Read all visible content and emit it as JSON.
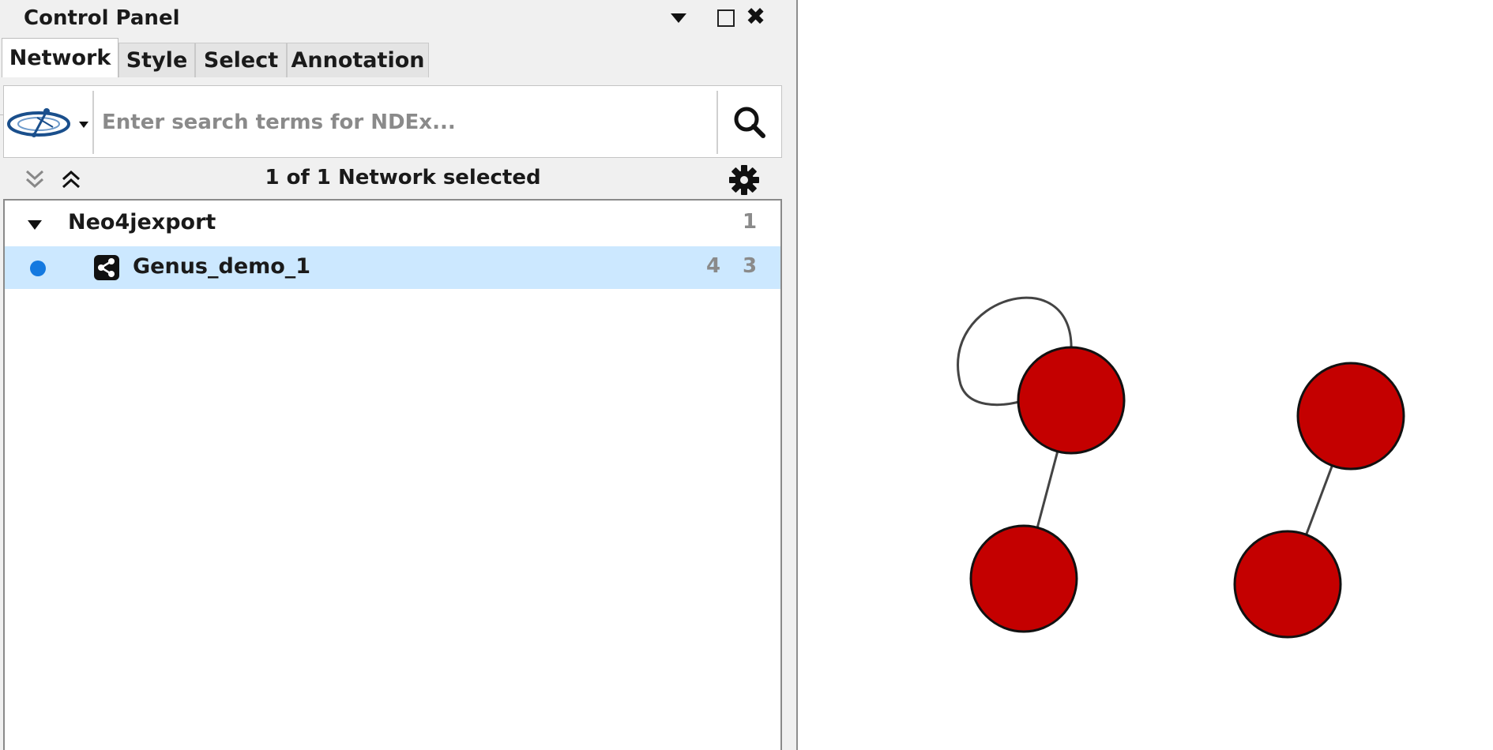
{
  "panel": {
    "title": "Control Panel"
  },
  "tabs": [
    {
      "label": "Network",
      "active": true
    },
    {
      "label": "Style",
      "active": false
    },
    {
      "label": "Select",
      "active": false
    },
    {
      "label": "Annotation",
      "active": false
    }
  ],
  "search": {
    "placeholder": "Enter search terms for NDEx...",
    "value": ""
  },
  "network_list": {
    "selected_summary": "1 of 1 Network selected",
    "collections": [
      {
        "name": "Neo4jexport",
        "count": "1",
        "networks": [
          {
            "name": "Genus_demo_1",
            "nodes": "4",
            "edges": "3",
            "selected": true
          }
        ]
      }
    ]
  },
  "icons": {
    "ndex": "ndex-logo-icon",
    "search": "search-icon",
    "gear": "gear-icon",
    "collapse": "collapse-all-icon",
    "expand": "expand-all-icon",
    "network": "network-share-icon"
  },
  "colors": {
    "node_fill": "#c40000",
    "node_stroke": "#111111",
    "edge": "#444444",
    "selection": "#cce8ff",
    "current_dot": "#1479e0"
  },
  "graph": {
    "nodes": [
      {
        "id": "n1"
      },
      {
        "id": "n2"
      },
      {
        "id": "n3"
      },
      {
        "id": "n4"
      }
    ],
    "edges": [
      {
        "source": "n1",
        "target": "n1"
      },
      {
        "source": "n1",
        "target": "n2"
      },
      {
        "source": "n3",
        "target": "n4"
      }
    ]
  }
}
